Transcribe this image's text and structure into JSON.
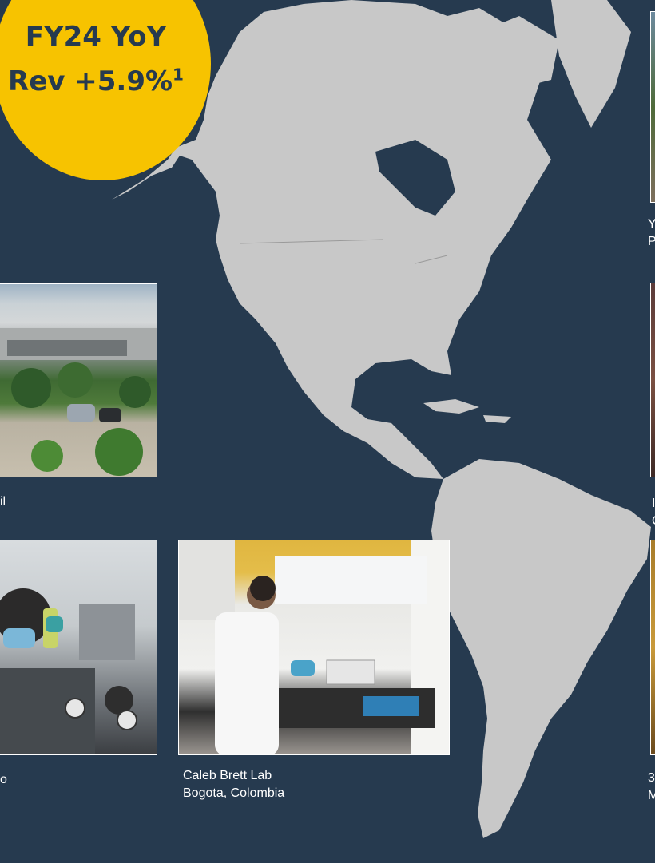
{
  "badge": {
    "line1": "FY24 YoY",
    "line2": "Rev +5.9%",
    "footnote": "1"
  },
  "captions": {
    "left_mid": {
      "line1": "il"
    },
    "left_bottom": {
      "line1": "o"
    },
    "center_bottom": {
      "line1": "Caleb Brett Lab",
      "line2": "Bogota, Colombia"
    },
    "right_top": {
      "line1": "Y",
      "line2": "P"
    },
    "right_mid": {
      "line1": "I",
      "line2": "C"
    },
    "right_bottom": {
      "line1": "3",
      "line2": "M"
    }
  },
  "colors": {
    "background": "#263a4f",
    "land": "#c8c8c8",
    "badge": "#f7c300",
    "badge_text": "#263a4f"
  }
}
